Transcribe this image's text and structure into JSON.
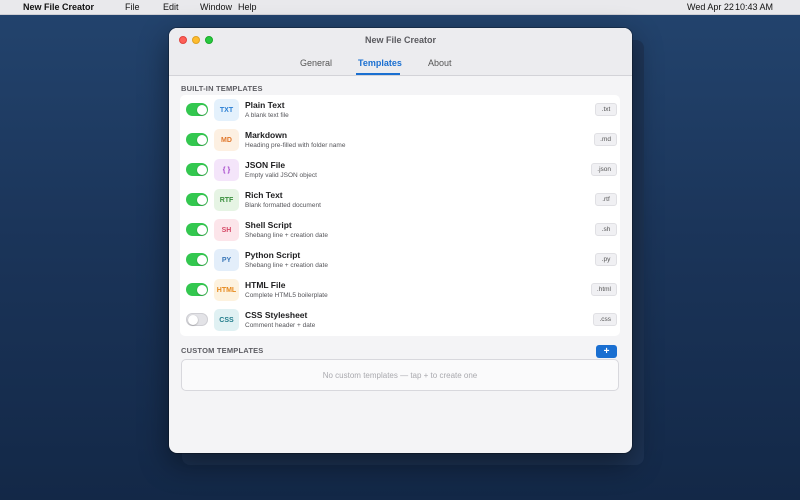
{
  "menubar": {
    "apple_glyph": "",
    "app_name": "New File Creator",
    "menus": [
      "File",
      "Edit",
      "Window",
      "Help"
    ],
    "date": "Wed Apr 22",
    "time": "10:43 AM"
  },
  "window": {
    "title": "New File Creator",
    "tabs": [
      {
        "label": "General",
        "selected": false
      },
      {
        "label": "Templates",
        "selected": true
      },
      {
        "label": "About",
        "selected": false
      }
    ]
  },
  "builtin": {
    "section_label": "BUILT-IN TEMPLATES",
    "templates": [
      {
        "enabled": true,
        "icon": "TXT",
        "icon_color": "#2a7fd4",
        "icon_bg": "#e4f1fc",
        "name": "Plain Text",
        "desc": "A blank text file",
        "ext": ".txt"
      },
      {
        "enabled": true,
        "icon": "MD",
        "icon_color": "#e0772b",
        "icon_bg": "#fdf0e2",
        "name": "Markdown",
        "desc": "Heading pre-filled with folder name",
        "ext": ".md"
      },
      {
        "enabled": true,
        "icon": "{ }",
        "icon_color": "#a23cc8",
        "icon_bg": "#f4e5fa",
        "name": "JSON File",
        "desc": "Empty valid JSON object",
        "ext": ".json"
      },
      {
        "enabled": true,
        "icon": "RTF",
        "icon_color": "#3a8f3d",
        "icon_bg": "#e6f4e4",
        "name": "Rich Text",
        "desc": "Blank formatted document",
        "ext": ".rtf"
      },
      {
        "enabled": true,
        "icon": "SH",
        "icon_color": "#d64a67",
        "icon_bg": "#fce5ea",
        "name": "Shell Script",
        "desc": "Shebang line + creation date",
        "ext": ".sh"
      },
      {
        "enabled": true,
        "icon": "PY",
        "icon_color": "#3b78b8",
        "icon_bg": "#e3eefa",
        "name": "Python Script",
        "desc": "Shebang line + creation date",
        "ext": ".py"
      },
      {
        "enabled": true,
        "icon": "HTML",
        "icon_color": "#e68a1f",
        "icon_bg": "#fdf2df",
        "name": "HTML File",
        "desc": "Complete HTML5 boilerplate",
        "ext": ".html"
      },
      {
        "enabled": false,
        "icon": "CSS",
        "icon_color": "#1f7b8a",
        "icon_bg": "#e0f1f3",
        "name": "CSS Stylesheet",
        "desc": "Comment header + date",
        "ext": ".css"
      }
    ]
  },
  "custom": {
    "section_label": "CUSTOM TEMPLATES",
    "add_label": "+",
    "empty_text": "No custom templates — tap + to create one"
  },
  "colors": {
    "accent": "#1a6fd1",
    "toggle_on": "#33c74f"
  }
}
